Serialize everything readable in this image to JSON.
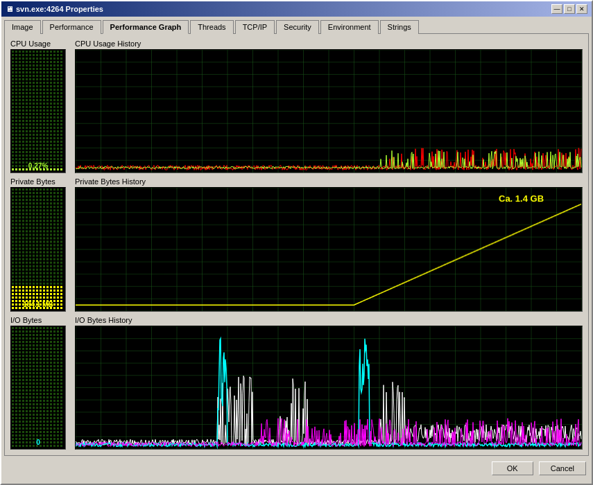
{
  "window": {
    "title": "svn.exe:4264 Properties",
    "controls": {
      "minimize": "—",
      "maximize": "□",
      "close": "✕"
    }
  },
  "tabs": [
    {
      "label": "Image",
      "active": false
    },
    {
      "label": "Performance",
      "active": false
    },
    {
      "label": "Performance Graph",
      "active": true
    },
    {
      "label": "Threads",
      "active": false
    },
    {
      "label": "TCP/IP",
      "active": false
    },
    {
      "label": "Security",
      "active": false
    },
    {
      "label": "Environment",
      "active": false
    },
    {
      "label": "Strings",
      "active": false
    }
  ],
  "sections": [
    {
      "id": "cpu",
      "gauge_label": "CPU Usage",
      "graph_label": "CPU Usage History",
      "value": "0.27%",
      "value_color": "#adff2f"
    },
    {
      "id": "private",
      "gauge_label": "Private Bytes",
      "graph_label": "Private Bytes History",
      "value": "184.1 MB",
      "value_color": "#ffff00",
      "annotation": "Ca. 1.4 GB"
    },
    {
      "id": "io",
      "gauge_label": "I/O Bytes",
      "graph_label": "I/O Bytes History",
      "value": "0",
      "value_color": "#00ffff"
    }
  ],
  "buttons": {
    "ok": "OK",
    "cancel": "Cancel"
  },
  "colors": {
    "grid_line": "#1a4a1a",
    "cpu_line": "#ff0000",
    "cpu_line2": "#adff2f",
    "private_line": "#ffff00",
    "io_line_white": "#ffffff",
    "io_line_cyan": "#00ffff",
    "io_line_magenta": "#ff00ff"
  }
}
